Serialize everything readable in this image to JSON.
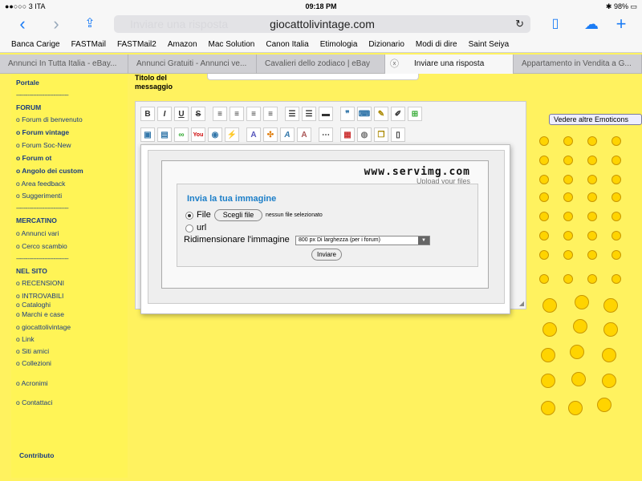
{
  "status": {
    "carrier": "3 ITA",
    "time": "09:18 PM",
    "battery": "98%"
  },
  "browser": {
    "url": "giocattolivintage.com",
    "ghost_title": "Inviare una risposta",
    "bookmarks": [
      "Banca Carige",
      "FASTMail",
      "FASTMail2",
      "Amazon",
      "Mac Solution",
      "Canon Italia",
      "Etimologia",
      "Dizionario",
      "Modi di dire",
      "Saint Seiya"
    ],
    "tabs": [
      {
        "label": "Annunci In Tutta Italia - eBay..."
      },
      {
        "label": "Annunci Gratuiti - Annunci ve..."
      },
      {
        "label": "Cavalieri dello zodiaco | eBay"
      },
      {
        "label": "Inviare una risposta"
      },
      {
        "label": "Appartamento in Vendita a G..."
      }
    ]
  },
  "sidebar": {
    "portale": "Portale",
    "sep": "----------------------------",
    "forum_h": "FORUM",
    "forum": [
      "o Forum di benvenuto",
      "o Forum vintage",
      "o Forum Soc-New",
      "o Forum ot",
      "o Angolo dei custom",
      "o Area feedback",
      "o Suggerimenti"
    ],
    "mercatino_h": "MERCATINO",
    "mercatino": [
      "o Annunci vari",
      "o Cerco scambio"
    ],
    "nelsito_h": "NEL SITO",
    "nelsito": [
      "o RECENSIONI",
      "o INTROVABILI",
      "o Cataloghi",
      "o Marchi e case",
      "o giocattolivintage",
      "o Link",
      "o Siti amici",
      "o Collezioni",
      "o Acronimi",
      "o Contattaci"
    ],
    "contributo": "Contributo"
  },
  "message_label": "Titolo del messaggio",
  "upload": {
    "logo": "www.servimg.com",
    "slogan": "Upload your files",
    "title": "Invia la tua immagine",
    "file_label": "File",
    "choose_btn": "Scegli file",
    "no_file": "nessun file selezionato",
    "url_label": "url",
    "resize_label": "Ridimensionare l'immagine",
    "resize_value": "800 px Di larghezza (per i forum)",
    "submit": "Inviare"
  },
  "emoticons_btn": "Vedere altre Emoticons"
}
